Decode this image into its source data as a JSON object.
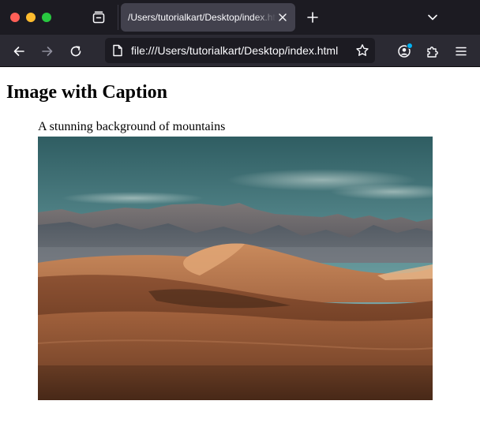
{
  "browser": {
    "tab": {
      "title": "/Users/tutorialkart/Desktop/index.html"
    },
    "address_bar": {
      "url": "file:///Users/tutorialkart/Desktop/index.html"
    }
  },
  "page": {
    "heading": "Image with Caption",
    "figure": {
      "caption": "A stunning background of mountains",
      "image_description": "desert sand dunes with mountains under a cloudy teal sky"
    }
  },
  "theme": {
    "chrome_dark": "#1c1b22",
    "toolbar": "#2b2a33",
    "tab_active": "#42414d",
    "text_light": "#fbfbfe",
    "accent_dot": "#00b3f4"
  },
  "icons": {
    "close": "red-traffic-light-icon",
    "minimize": "yellow-traffic-light-icon",
    "maximize": "green-traffic-light-icon",
    "tab_manager": "tab-manager-icon",
    "tab_close": "close-icon",
    "new_tab": "plus-icon",
    "list_tabs": "chevron-down-icon",
    "back": "arrow-left-icon",
    "forward": "arrow-right-icon",
    "reload": "reload-icon",
    "page": "page-icon",
    "bookmark": "star-icon",
    "account": "account-icon",
    "extensions": "puzzle-icon",
    "menu": "hamburger-menu-icon"
  }
}
